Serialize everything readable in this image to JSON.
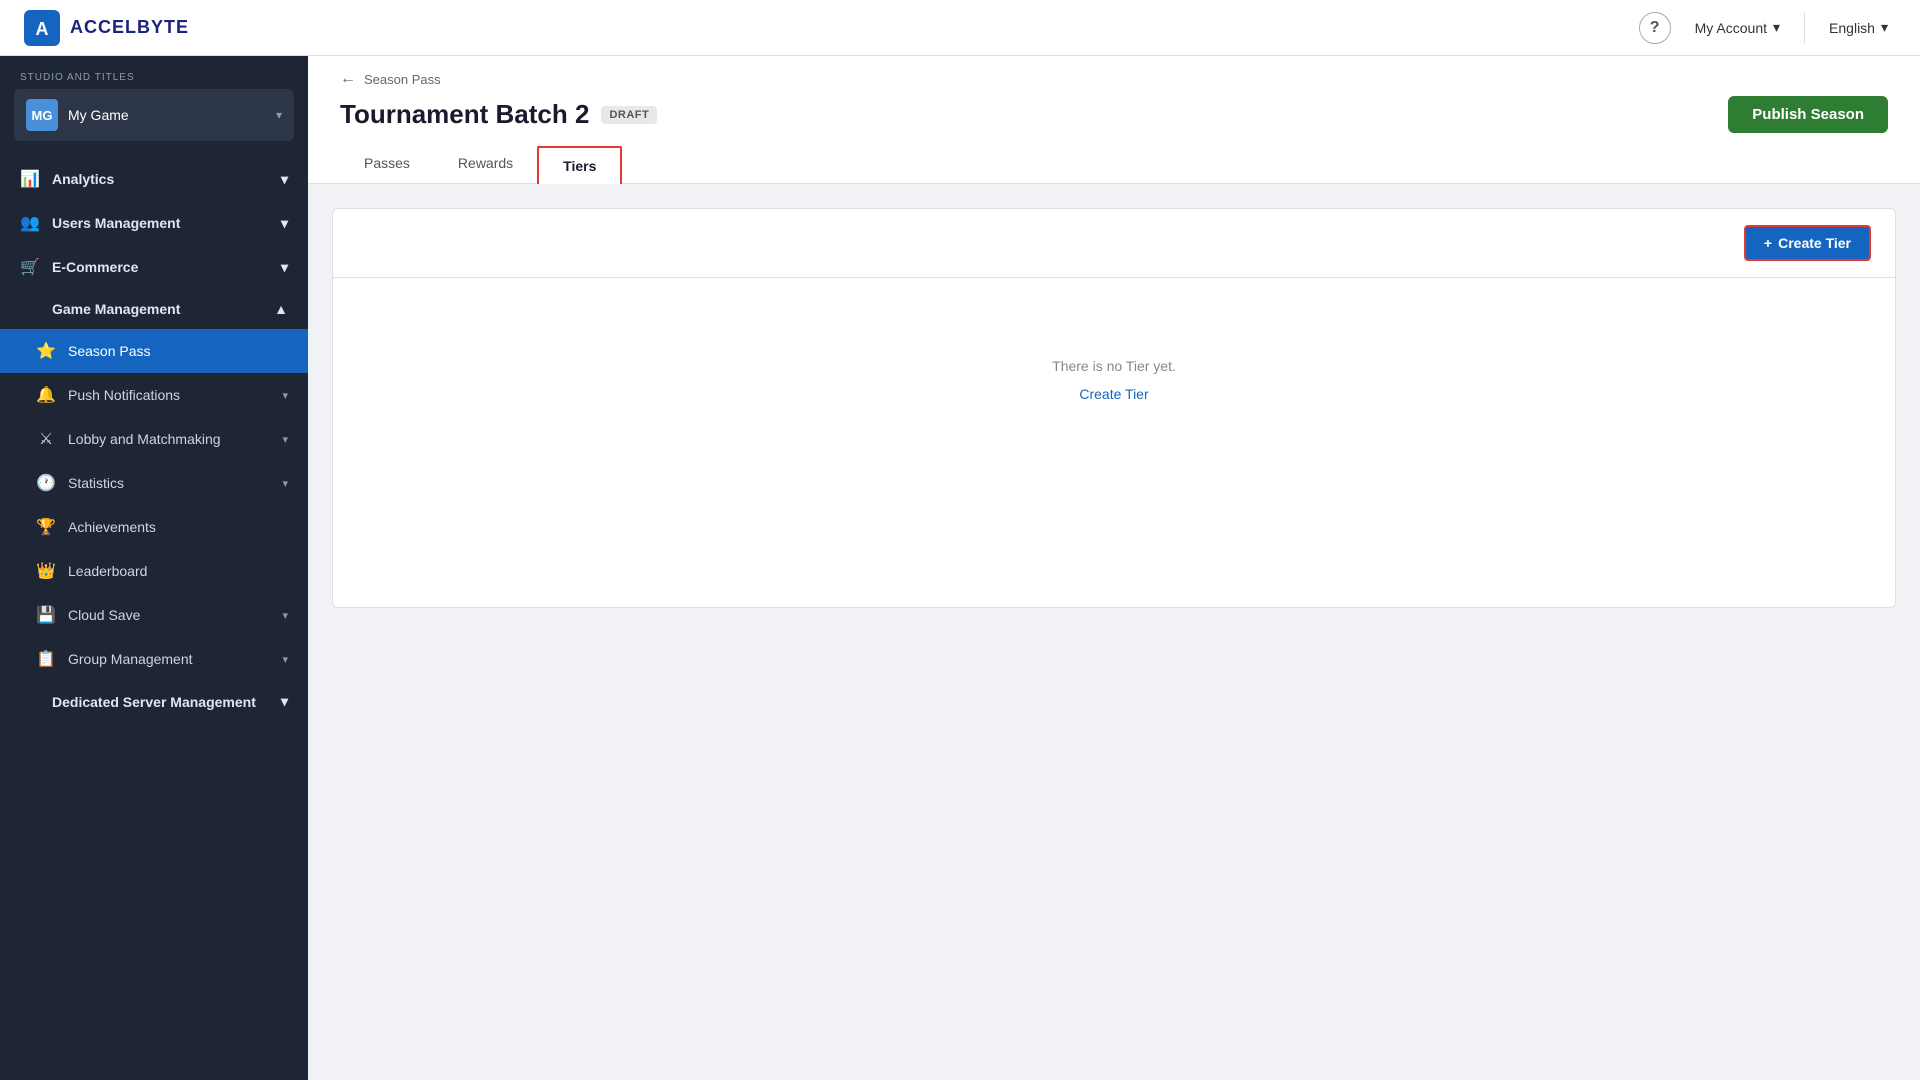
{
  "header": {
    "logo_text": "ACCELBYTE",
    "help_label": "?",
    "account_label": "My Account",
    "language_label": "English"
  },
  "sidebar": {
    "studio_label": "STUDIO AND TITLES",
    "game_avatar": "MG",
    "game_name": "My Game",
    "nav_items": [
      {
        "id": "analytics",
        "label": "Analytics",
        "has_children": true,
        "icon": "📊"
      },
      {
        "id": "users-management",
        "label": "Users Management",
        "has_children": true,
        "icon": "👥"
      },
      {
        "id": "e-commerce",
        "label": "E-Commerce",
        "has_children": true,
        "icon": "🛒"
      },
      {
        "id": "game-management",
        "label": "Game Management",
        "has_children": true,
        "icon": "",
        "expanded": true
      },
      {
        "id": "season-pass",
        "label": "Season Pass",
        "has_children": false,
        "icon": "⭐",
        "active": true,
        "is_child": true
      },
      {
        "id": "push-notifications",
        "label": "Push Notifications",
        "has_children": true,
        "icon": "🔔",
        "is_child": true
      },
      {
        "id": "lobby-matchmaking",
        "label": "Lobby and Matchmaking",
        "has_children": true,
        "icon": "⚔",
        "is_child": true
      },
      {
        "id": "statistics",
        "label": "Statistics",
        "has_children": true,
        "icon": "🕐",
        "is_child": true
      },
      {
        "id": "achievements",
        "label": "Achievements",
        "has_children": false,
        "icon": "🏆",
        "is_child": true
      },
      {
        "id": "leaderboard",
        "label": "Leaderboard",
        "has_children": false,
        "icon": "👑",
        "is_child": true
      },
      {
        "id": "cloud-save",
        "label": "Cloud Save",
        "has_children": true,
        "icon": "💾",
        "is_child": true
      },
      {
        "id": "group-management",
        "label": "Group Management",
        "has_children": true,
        "icon": "📋",
        "is_child": true
      },
      {
        "id": "dedicated-server",
        "label": "Dedicated Server Management",
        "has_children": true,
        "icon": ""
      }
    ]
  },
  "page": {
    "breadcrumb_arrow": "←",
    "breadcrumb_label": "Season Pass",
    "title": "Tournament Batch 2",
    "badge": "DRAFT",
    "publish_button": "Publish Season"
  },
  "tabs": [
    {
      "id": "passes",
      "label": "Passes",
      "active": false
    },
    {
      "id": "rewards",
      "label": "Rewards",
      "active": false
    },
    {
      "id": "tiers",
      "label": "Tiers",
      "active": true
    }
  ],
  "content": {
    "create_tier_icon": "+",
    "create_tier_label": "Create Tier",
    "empty_text": "There is no Tier yet.",
    "empty_link": "Create Tier"
  }
}
